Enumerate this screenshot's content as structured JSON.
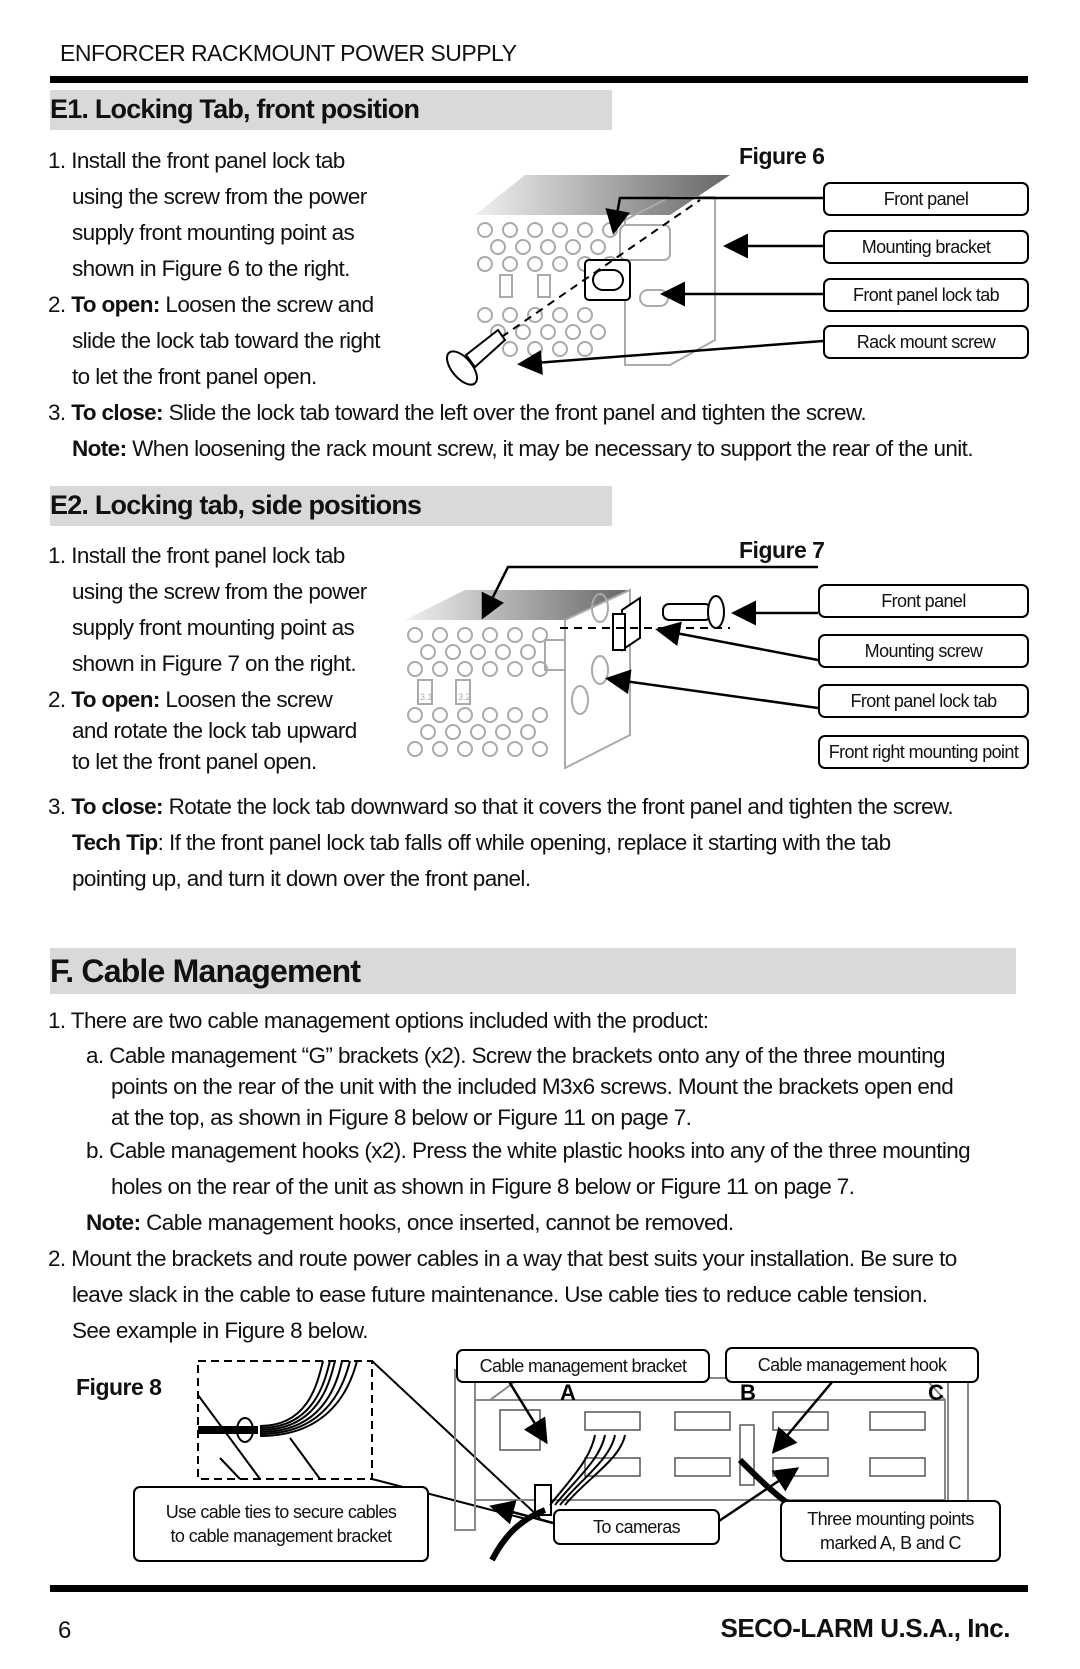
{
  "header": {
    "running_title": "ENFORCER RACKMOUNT POWER SUPPLY"
  },
  "section_e1": {
    "title": "E1. Locking Tab, front position",
    "steps": [
      {
        "num": "1.",
        "lines": [
          "Install the front panel lock tab",
          "using the screw from the power",
          "supply front mounting point as",
          "shown in Figure 6 to the right."
        ]
      },
      {
        "num": "2.",
        "bold": "To open:",
        "lines": [
          "Loosen the screw and",
          "slide the lock tab toward the right",
          "to let the front panel open."
        ]
      },
      {
        "num": "3.",
        "bold": "To close:",
        "text": "Slide the lock tab toward the left over the front panel and tighten the screw."
      }
    ],
    "note_label": "Note:",
    "note_text": "When loosening the rack mount screw, it may be necessary to support the rear of the unit.",
    "figure": {
      "title": "Figure 6",
      "callouts": [
        "Front panel",
        "Mounting bracket",
        "Front panel lock tab",
        "Rack mount screw"
      ],
      "icons": [
        "power-supply-front-illustration",
        "mounting-bracket-illustration",
        "lock-tab-illustration",
        "rack-screw-illustration"
      ]
    }
  },
  "section_e2": {
    "title": "E2. Locking tab, side positions",
    "steps": [
      {
        "num": "1.",
        "lines": [
          "Install the front panel lock tab",
          "using the screw from the power",
          "supply front mounting point as",
          "shown in Figure 7 on the right."
        ]
      },
      {
        "num": "2.",
        "bold": "To open:",
        "lines": [
          "Loosen the screw",
          "and rotate the lock tab upward",
          "to let the front panel open."
        ]
      },
      {
        "num": "3.",
        "bold": "To close:",
        "text": "Rotate the lock tab downward so that it covers the front panel and tighten the screw."
      }
    ],
    "tip_label": "Tech Tip",
    "tip_lines": [
      ": If the front panel lock tab falls off while opening, replace it starting with the tab",
      "pointing up, and turn it down over the front panel."
    ],
    "figure": {
      "title": "Figure 7",
      "callouts": [
        "Front panel",
        "Mounting screw",
        "Front panel lock tab",
        "Front right mounting point"
      ],
      "fuse_labels": [
        "3.1",
        "3.2"
      ]
    }
  },
  "section_f": {
    "title": "F. Cable Management",
    "item1": "1. There are two cable management options included with the product:",
    "item1a_lines": [
      "a. Cable management “G” brackets (x2).  Screw the brackets onto any of the three mounting",
      "points on the rear of the unit with the included M3x6 screws.  Mount the brackets open end",
      "at the top, as shown in Figure 8 below or Figure 11 on page 7."
    ],
    "item1b_lines": [
      "b. Cable management hooks (x2).  Press the white plastic hooks into any of the three mounting",
      "holes on the rear of the unit as shown in Figure 8 below or Figure 11 on page 7."
    ],
    "note_label": "Note:",
    "note_text": "Cable management hooks, once inserted, cannot be removed.",
    "item2_lines": [
      "2. Mount the brackets and route power cables in a way that best suits your installation.  Be sure to",
      "leave slack in the cable to ease future maintenance.  Use cable ties to reduce cable tension.",
      "See example in Figure 8 below."
    ],
    "figure": {
      "title": "Figure 8",
      "callouts": {
        "bracket": "Cable management bracket",
        "hook": "Cable management hook",
        "ties_line1": "Use cable ties to secure cables",
        "ties_line2": "to cable management bracket",
        "cameras": "To cameras",
        "points_line1": "Three mounting points",
        "points_line2": "marked A, B and C"
      },
      "point_labels": [
        "A",
        "B",
        "C"
      ]
    }
  },
  "footer": {
    "page_number": "6",
    "company": "SECO-LARM U.S.A., Inc."
  }
}
